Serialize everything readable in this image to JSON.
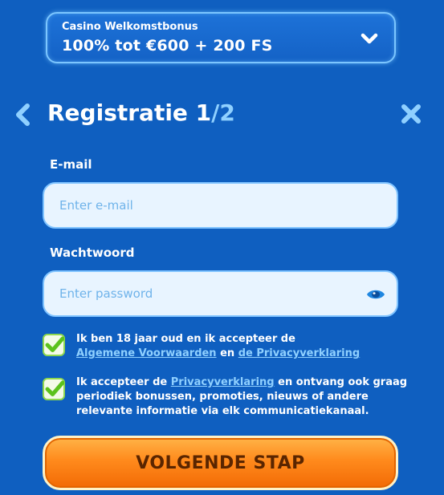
{
  "bonus": {
    "label": "Casino Welkomstbonus",
    "offer": "100% tot €600 + 200 FS"
  },
  "header": {
    "title": "Registratie",
    "step_current": "1",
    "step_separator": "/",
    "step_total": "2"
  },
  "form": {
    "email_label": "E-mail",
    "email_placeholder": "Enter e-mail",
    "email_value": "",
    "password_label": "Wachtwoord",
    "password_placeholder": "Enter password",
    "password_value": ""
  },
  "consents": [
    {
      "checked": true,
      "text_before": "Ik ben 18 jaar oud en ik accepteer de",
      "link1": "Algemene Voorwaarden",
      "text_middle": "en",
      "link2": "de Privacyverklaring"
    },
    {
      "checked": true,
      "text_before": "Ik accepteer de",
      "link1": "Privacyverklaring",
      "text_after": "en ontvang ook graag periodiek bonussen, promoties, nieuws of andere relevante informatie via elk communicatiekanaal."
    }
  ],
  "next_button_label": "VOLGENDE STAP",
  "colors": {
    "background": "#0f5fc0",
    "accent_light": "#8fd0ff",
    "input_bg": "#e8f4ff",
    "checkbox_green": "#5cc21c",
    "button_orange": "#ff8a1c"
  },
  "icons": [
    "chevron-down-icon",
    "back-arrow-icon",
    "close-icon",
    "eye-icon",
    "checkmark-icon"
  ]
}
